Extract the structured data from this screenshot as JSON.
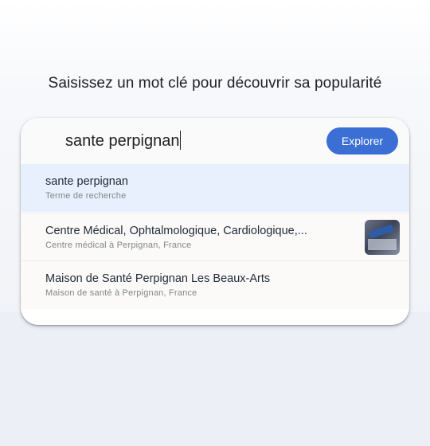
{
  "headline": "Saisissez un mot clé pour découvrir sa popularité",
  "search": {
    "value": "sante perpignan",
    "button_label": "Explorer"
  },
  "suggestions": [
    {
      "title": "sante perpignan",
      "subtitle": "Terme de recherche",
      "has_thumbnail": false,
      "highlighted": true
    },
    {
      "title": "Centre Médical, Ophtalmologique, Cardiologique,...",
      "subtitle": "Centre médical à Perpignan, France",
      "has_thumbnail": true,
      "highlighted": false
    },
    {
      "title": "Maison de Santé Perpignan Les Beaux-Arts",
      "subtitle": "Maison de santé à Perpignan, France",
      "has_thumbnail": false,
      "highlighted": false
    }
  ],
  "colors": {
    "accent": "#3b6fd4",
    "highlight": "#e8f0fe"
  }
}
